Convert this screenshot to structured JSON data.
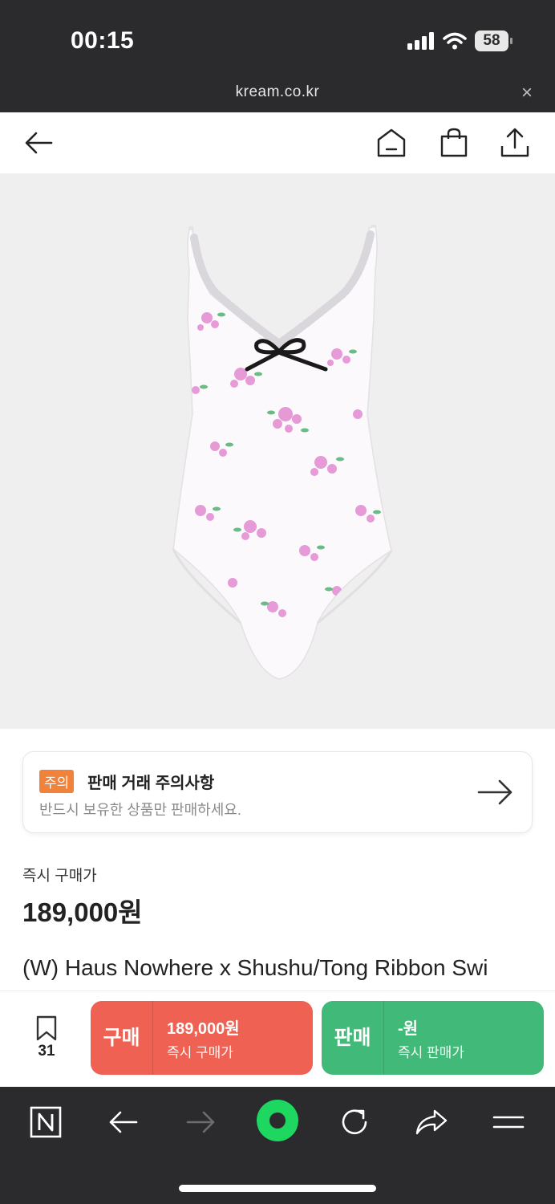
{
  "status_bar": {
    "time": "00:15",
    "battery": "58"
  },
  "browser_url": {
    "domain": "kream.co.kr",
    "close_label": "×"
  },
  "notice": {
    "badge": "주의",
    "title": "판매 거래 주의사항",
    "subtitle": "반드시 보유한 상품만 판매하세요."
  },
  "product": {
    "instant_price_label": "즉시 구매가",
    "instant_price": "189,000원",
    "name": "(W) Haus Nowhere x Shushu/Tong Ribbon Swi"
  },
  "action_bar": {
    "wish_count": "31",
    "buy": {
      "label": "구매",
      "price": "189,000원",
      "sub": "즉시 구매가",
      "color": "#ef6253"
    },
    "sell": {
      "label": "판매",
      "price": "-원",
      "sub": "즉시 판매가",
      "color": "#41b979"
    }
  },
  "colors": {
    "notice_badge": "#f0823b",
    "browser_chrome": "#2b2b2d",
    "naver_green": "#1ed760"
  }
}
